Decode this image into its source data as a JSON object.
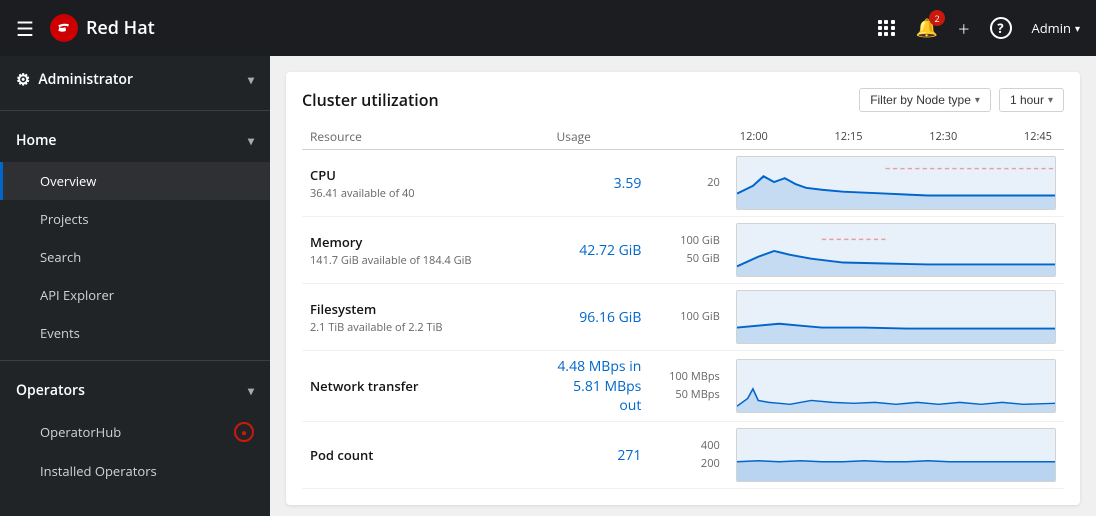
{
  "topNav": {
    "hamburger_label": "☰",
    "brand_name": "Red Hat",
    "notifications_count": "2",
    "admin_label": "Admin",
    "admin_caret": "▾",
    "grid_label": "apps",
    "help_label": "?",
    "plus_label": "+"
  },
  "sidebar": {
    "admin_section": "Administrator",
    "home_section": "Home",
    "operators_section": "Operators",
    "items": {
      "overview": "Overview",
      "projects": "Projects",
      "search": "Search",
      "api_explorer": "API Explorer",
      "events": "Events",
      "operator_hub": "OperatorHub",
      "installed_operators": "Installed Operators"
    }
  },
  "content": {
    "card_title": "Cluster utilization",
    "filter_node_label": "Filter by Node type",
    "filter_time_label": "1 hour",
    "table_headers": {
      "resource": "Resource",
      "usage": "Usage",
      "time_1200": "12:00",
      "time_1215": "12:15",
      "time_1230": "12:30",
      "time_1245": "12:45"
    },
    "rows": [
      {
        "name": "CPU",
        "sub": "36.41 available of 40",
        "usage": "3.59",
        "scale_high": "20",
        "scale_low": "",
        "has_dotted": true
      },
      {
        "name": "Memory",
        "sub": "141.7 GiB available of 184.4 GiB",
        "usage": "42.72 GiB",
        "scale_high": "100 GiB",
        "scale_low": "50 GiB",
        "has_dotted": true
      },
      {
        "name": "Filesystem",
        "sub": "2.1 TiB available of 2.2 TiB",
        "usage": "96.16 GiB",
        "scale_high": "100 GiB",
        "scale_low": "",
        "has_dotted": false
      },
      {
        "name": "Network transfer",
        "sub": "",
        "usage_line1": "4.48 MBps in",
        "usage_line2": "5.81 MBps out",
        "scale_high": "100 MBps",
        "scale_low": "50 MBps",
        "has_dotted": false,
        "multi": true
      },
      {
        "name": "Pod count",
        "sub": "",
        "usage": "271",
        "scale_high": "400",
        "scale_low": "200",
        "has_dotted": false
      }
    ]
  }
}
